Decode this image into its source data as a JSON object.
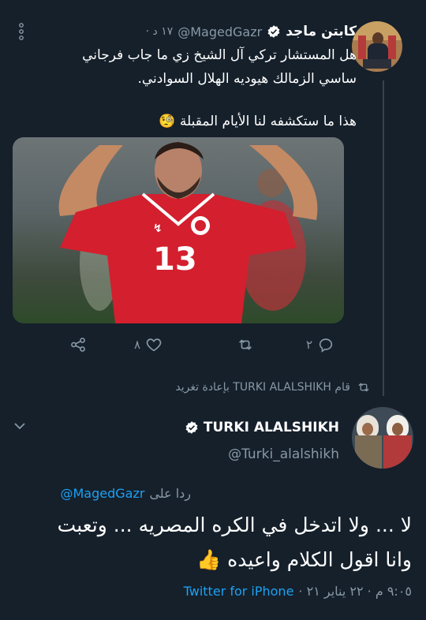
{
  "quoted_tweet": {
    "author_name": "كابتن ماجد",
    "verified": true,
    "handle": "@MagedGazr",
    "time": "· ١٧ د",
    "text_line1": "هل المستشار تركي آل الشيخ زي ما جاب فرجاني",
    "text_line2": "ساسي الزمالك هيوديه الهلال السوادني.",
    "text_line3": "هذا ما ستكشفه لنا الأيام المقبلة",
    "emoji": "🧐",
    "image_alt": "player-in-red-jersey-13",
    "jersey_number": "13",
    "actions": {
      "reply_count": "٢",
      "retweet_count": "",
      "like_count": "٨"
    }
  },
  "retweet_notice": "قام TURKI ALALSHIKH بإعادة تغريد",
  "main_tweet": {
    "author_name": "TURKI ALALSHIKH",
    "handle": "@Turki_alalshikh",
    "reply_to_prefix": "ردا على",
    "reply_to_handle": "@MagedGazr",
    "text_line1": "لا ... ولا اتدخل في الكره المصريه ... وتعبت",
    "text_line2": "وانا اقول الكلام واعيده",
    "emoji": "👍",
    "timestamp": "٩:٠٥ م · ٢٢ يناير ٢١ ·",
    "source": "Twitter for iPhone"
  },
  "colors": {
    "background": "#15202b",
    "accent": "#1da1f2",
    "muted": "#8899a6",
    "divider": "#38444d"
  }
}
